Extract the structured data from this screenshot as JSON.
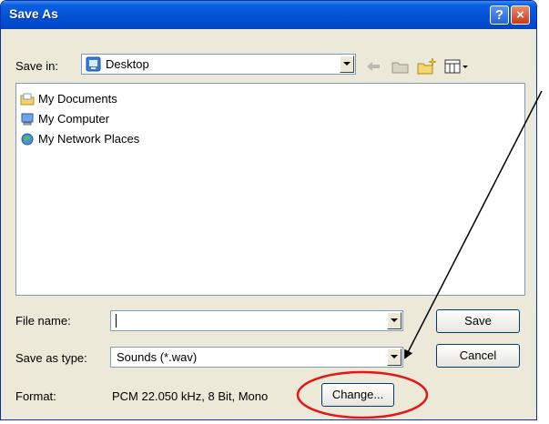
{
  "dialog": {
    "title": "Save As",
    "help_glyph": "?",
    "close_glyph": "×"
  },
  "save_in": {
    "label": "Save in:",
    "value": "Desktop"
  },
  "files": [
    {
      "name": "My Documents",
      "icon": "folder-icon"
    },
    {
      "name": "My Computer",
      "icon": "computer-icon"
    },
    {
      "name": "My Network Places",
      "icon": "network-icon"
    }
  ],
  "file_name": {
    "label": "File name:",
    "value": ""
  },
  "save_as_type": {
    "label": "Save as type:",
    "value": "Sounds (*.wav)"
  },
  "format": {
    "label": "Format:",
    "value": "PCM 22.050 kHz, 8 Bit, Mono"
  },
  "buttons": {
    "save": "Save",
    "cancel": "Cancel",
    "change": "Change..."
  },
  "colors": {
    "title_bar": "#0252d6",
    "dialog_bg": "#ece9d8",
    "annotation": "#e01818"
  }
}
